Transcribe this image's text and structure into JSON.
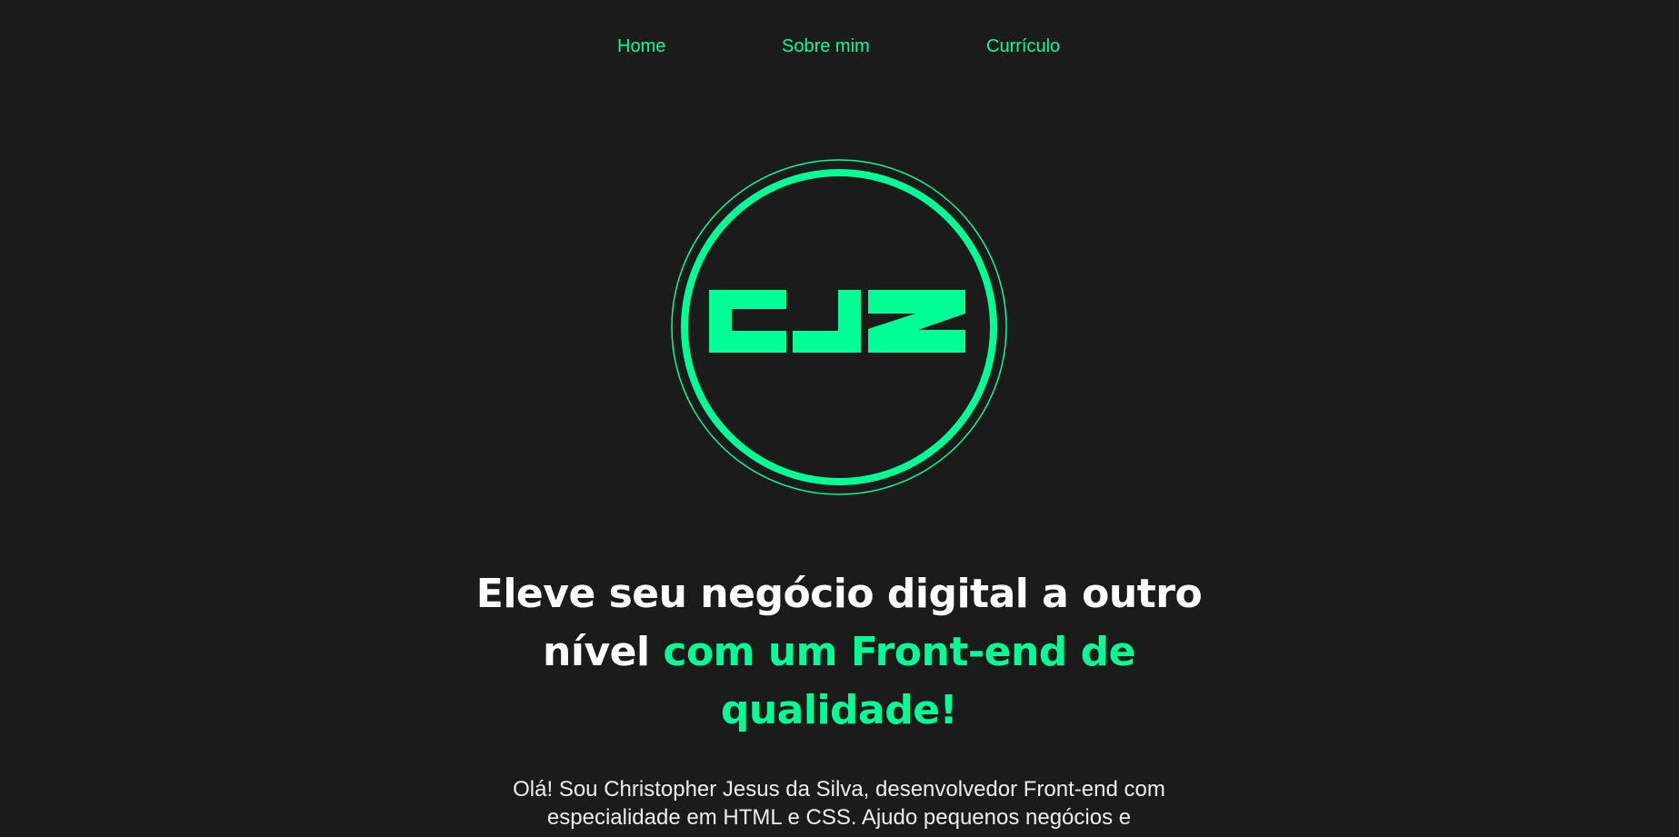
{
  "nav": {
    "items": [
      {
        "label": "Home"
      },
      {
        "label": "Sobre mim"
      },
      {
        "label": "Currículo"
      }
    ]
  },
  "logo": {
    "text": "CJS",
    "color": "#00ff95"
  },
  "hero": {
    "title_white": "Eleve seu negócio digital a outro nível ",
    "title_accent": "com um Front-end de qualidade!",
    "intro": "Olá! Sou Christopher Jesus da Silva, desenvolvedor Front-end com especialidade em HTML e CSS. Ajudo pequenos negócios e"
  },
  "colors": {
    "background": "#1b1b1b",
    "accent": "#00ff95",
    "text": "#ffffff"
  }
}
